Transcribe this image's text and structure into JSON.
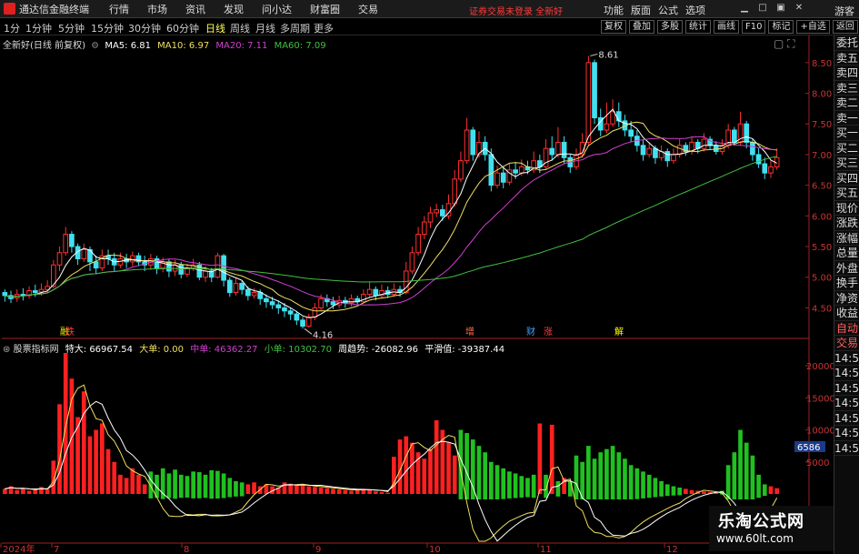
{
  "app": {
    "title": "通达信金融终端",
    "guest": "游客",
    "notice": "证券交易未登录 全新好"
  },
  "menu": [
    "行情",
    "市场",
    "资讯",
    "发现",
    "问小达",
    "财富圈",
    "交易"
  ],
  "right_menu": [
    "功能",
    "版面",
    "公式",
    "选项"
  ],
  "periods": [
    "1分",
    "1分钟",
    "5分钟",
    "15分钟",
    "30分钟",
    "60分钟",
    "日线",
    "周线",
    "月线",
    "多周期",
    "更多"
  ],
  "active_period": "日线",
  "toolbar": [
    "复权",
    "叠加",
    "多股",
    "统计",
    "画线",
    "F10",
    "标记",
    "+自选",
    "返回"
  ],
  "main_info": {
    "stock": "全新好(日线 前复权)",
    "ma5": "MA5: 6.81",
    "ma10": "MA10: 6.97",
    "ma20": "MA20: 7.11",
    "ma60": "MA60: 7.09",
    "colors": {
      "ma5": "#ffffff",
      "ma10": "#f0e060",
      "ma20": "#d040d0",
      "ma60": "#40c040"
    }
  },
  "annotations": {
    "high": "8.61",
    "low": "4.16"
  },
  "markers": [
    {
      "label": "融",
      "color": "#ffff00"
    },
    {
      "label": "跌",
      "color": "#ff4040"
    },
    {
      "label": "增",
      "color": "#ff7040"
    },
    {
      "label": "财",
      "color": "#40a0ff"
    },
    {
      "label": "涨",
      "color": "#ff4040"
    },
    {
      "label": "解",
      "color": "#ffff00"
    }
  ],
  "sub_info": {
    "name": "股票指标网",
    "te_da": "特大: 66967.54",
    "da_dan": "大单: 0.00",
    "zhong_dan": "中单: 46362.27",
    "xiao_dan": "小单: 10302.70",
    "zhou_qu_shi": "周趋势: -26082.96",
    "ping_hua": "平滑值: -39387.44",
    "colors": {
      "te_da": "#ffffff",
      "da_dan": "#f0e060",
      "zhong_dan": "#d040d0",
      "xiao_dan": "#40c040",
      "zhou_qu_shi": "#ffffff",
      "ping_hua": "#ffffff"
    }
  },
  "side_panel": [
    "委托",
    "卖五",
    "卖四",
    "卖三",
    "卖二",
    "卖一",
    "买一",
    "买二",
    "买三",
    "买四",
    "买五",
    "现价",
    "涨跌",
    "涨幅",
    "总量",
    "外盘",
    "换手",
    "净资",
    "收益",
    "自动",
    "交易",
    "14:55",
    "14:55",
    "14:55",
    "14:55",
    "14:55",
    "14:55",
    "14:55"
  ],
  "sub_price_tag": "6586",
  "x_axis": [
    "2024年",
    "7",
    "8",
    "9",
    "10",
    "11",
    "12"
  ],
  "watermark": {
    "title": "乐淘公式网",
    "url": "www.60lt.com"
  },
  "chart_data": [
    {
      "type": "candlestick",
      "title": "全新好(日线 前复权)",
      "y_ticks": [
        8.5,
        8.0,
        7.5,
        7.0,
        6.5,
        6.0,
        5.5,
        5.0,
        4.5
      ],
      "ylim": [
        4.15,
        8.75
      ],
      "annotations": [
        {
          "label": "8.61",
          "value": 8.61
        },
        {
          "label": "4.16",
          "value": 4.16
        }
      ],
      "x_labels": [
        "2024年",
        "7",
        "8",
        "9",
        "10",
        "11",
        "12"
      ],
      "candles": [
        [
          4.75,
          4.7,
          4.8,
          4.6
        ],
        [
          4.7,
          4.65,
          4.78,
          4.58
        ],
        [
          4.66,
          4.72,
          4.8,
          4.6
        ],
        [
          4.72,
          4.7,
          4.82,
          4.62
        ],
        [
          4.7,
          4.78,
          4.85,
          4.65
        ],
        [
          4.78,
          4.75,
          4.88,
          4.68
        ],
        [
          4.76,
          4.8,
          4.9,
          4.7
        ],
        [
          4.8,
          4.85,
          4.95,
          4.75
        ],
        [
          4.85,
          5.2,
          5.28,
          4.82
        ],
        [
          5.2,
          5.4,
          5.5,
          5.1
        ],
        [
          5.4,
          5.7,
          5.82,
          5.35
        ],
        [
          5.7,
          5.5,
          5.75,
          5.4
        ],
        [
          5.5,
          5.3,
          5.55,
          5.2
        ],
        [
          5.3,
          5.45,
          5.55,
          5.25
        ],
        [
          5.45,
          5.25,
          5.5,
          5.1
        ],
        [
          5.25,
          5.15,
          5.35,
          5.05
        ],
        [
          5.15,
          5.35,
          5.45,
          5.1
        ],
        [
          5.35,
          5.3,
          5.45,
          5.2
        ],
        [
          5.3,
          5.2,
          5.4,
          5.1
        ],
        [
          5.2,
          5.3,
          5.4,
          5.15
        ],
        [
          5.3,
          5.25,
          5.38,
          5.15
        ],
        [
          5.25,
          5.35,
          5.42,
          5.18
        ],
        [
          5.35,
          5.25,
          5.4,
          5.18
        ],
        [
          5.25,
          5.2,
          5.35,
          5.1
        ],
        [
          5.2,
          5.3,
          5.38,
          5.12
        ],
        [
          5.3,
          5.15,
          5.35,
          5.05
        ],
        [
          5.15,
          5.25,
          5.32,
          5.08
        ],
        [
          5.25,
          5.1,
          5.3,
          5.0
        ],
        [
          5.1,
          5.2,
          5.28,
          5.02
        ],
        [
          5.2,
          5.05,
          5.25,
          4.98
        ],
        [
          5.05,
          5.15,
          5.22,
          5.0
        ],
        [
          5.15,
          5.2,
          5.3,
          5.1
        ],
        [
          5.2,
          5.0,
          5.25,
          4.95
        ],
        [
          5.0,
          5.1,
          5.18,
          4.92
        ],
        [
          5.1,
          5.0,
          5.15,
          4.92
        ],
        [
          5.0,
          5.35,
          5.4,
          4.98
        ],
        [
          5.35,
          4.95,
          5.38,
          4.85
        ],
        [
          4.95,
          4.75,
          5.0,
          4.68
        ],
        [
          4.75,
          4.9,
          4.98,
          4.7
        ],
        [
          4.9,
          4.8,
          4.95,
          4.72
        ],
        [
          4.8,
          4.7,
          4.85,
          4.62
        ],
        [
          4.7,
          4.75,
          4.82,
          4.65
        ],
        [
          4.75,
          4.65,
          4.8,
          4.55
        ],
        [
          4.65,
          4.6,
          4.72,
          4.5
        ],
        [
          4.6,
          4.55,
          4.68,
          4.48
        ],
        [
          4.55,
          4.5,
          4.62,
          4.4
        ],
        [
          4.5,
          4.45,
          4.58,
          4.35
        ],
        [
          4.45,
          4.4,
          4.5,
          4.3
        ],
        [
          4.4,
          4.3,
          4.45,
          4.22
        ],
        [
          4.3,
          4.2,
          4.35,
          4.16
        ],
        [
          4.2,
          4.35,
          4.4,
          4.18
        ],
        [
          4.35,
          4.5,
          4.58,
          4.3
        ],
        [
          4.5,
          4.65,
          4.72,
          4.45
        ],
        [
          4.65,
          4.6,
          4.72,
          4.52
        ],
        [
          4.6,
          4.55,
          4.68,
          4.48
        ],
        [
          4.55,
          4.62,
          4.7,
          4.5
        ],
        [
          4.62,
          4.58,
          4.68,
          4.5
        ],
        [
          4.58,
          4.65,
          4.72,
          4.52
        ],
        [
          4.65,
          4.6,
          4.7,
          4.55
        ],
        [
          4.6,
          4.72,
          4.8,
          4.58
        ],
        [
          4.72,
          4.8,
          4.92,
          4.68
        ],
        [
          4.8,
          4.7,
          4.85,
          4.62
        ],
        [
          4.7,
          4.78,
          4.88,
          4.65
        ],
        [
          4.78,
          4.72,
          4.85,
          4.66
        ],
        [
          4.72,
          4.8,
          4.9,
          4.68
        ],
        [
          4.8,
          4.75,
          4.86,
          4.68
        ],
        [
          4.75,
          5.1,
          5.25,
          4.72
        ],
        [
          5.1,
          5.4,
          5.5,
          5.05
        ],
        [
          5.4,
          5.7,
          5.82,
          5.35
        ],
        [
          5.7,
          5.9,
          6.0,
          5.62
        ],
        [
          5.9,
          6.05,
          6.15,
          5.8
        ],
        [
          6.05,
          6.1,
          6.2,
          5.98
        ],
        [
          6.1,
          6.0,
          6.18,
          5.92
        ],
        [
          6.0,
          6.2,
          6.35,
          5.95
        ],
        [
          6.2,
          6.6,
          6.75,
          6.15
        ],
        [
          6.6,
          6.9,
          7.05,
          6.55
        ],
        [
          6.9,
          7.4,
          7.6,
          6.85
        ],
        [
          7.4,
          7.0,
          7.45,
          6.9
        ],
        [
          7.0,
          7.2,
          7.38,
          6.95
        ],
        [
          7.2,
          7.0,
          7.3,
          6.9
        ],
        [
          7.0,
          6.5,
          7.1,
          6.4
        ],
        [
          6.5,
          6.7,
          6.82,
          6.45
        ],
        [
          6.7,
          6.55,
          6.8,
          6.45
        ],
        [
          6.55,
          6.75,
          6.85,
          6.5
        ],
        [
          6.75,
          6.7,
          6.88,
          6.6
        ],
        [
          6.7,
          6.8,
          6.92,
          6.65
        ],
        [
          6.8,
          6.75,
          6.9,
          6.68
        ],
        [
          6.75,
          6.9,
          7.05,
          6.7
        ],
        [
          6.9,
          6.8,
          7.0,
          6.7
        ],
        [
          6.8,
          7.1,
          7.25,
          6.75
        ],
        [
          7.1,
          7.0,
          7.3,
          6.9
        ],
        [
          7.0,
          7.2,
          7.45,
          6.95
        ],
        [
          7.2,
          6.95,
          7.3,
          6.85
        ],
        [
          6.95,
          6.8,
          7.0,
          6.7
        ],
        [
          6.8,
          7.0,
          7.1,
          6.75
        ],
        [
          7.0,
          7.2,
          7.35,
          6.95
        ],
        [
          7.2,
          8.5,
          8.61,
          7.15
        ],
        [
          8.5,
          7.6,
          8.55,
          7.5
        ],
        [
          7.6,
          7.4,
          7.75,
          7.3
        ],
        [
          7.4,
          7.5,
          7.85,
          7.35
        ],
        [
          7.5,
          7.7,
          7.9,
          7.45
        ],
        [
          7.7,
          7.55,
          7.85,
          7.45
        ],
        [
          7.55,
          7.4,
          7.65,
          7.3
        ],
        [
          7.4,
          7.3,
          7.55,
          7.2
        ],
        [
          7.3,
          7.15,
          7.4,
          7.05
        ],
        [
          7.15,
          7.0,
          7.25,
          6.9
        ],
        [
          7.0,
          7.1,
          7.2,
          6.95
        ],
        [
          7.1,
          6.95,
          7.15,
          6.85
        ],
        [
          6.95,
          7.05,
          7.15,
          6.9
        ],
        [
          7.05,
          6.9,
          7.1,
          6.8
        ],
        [
          6.9,
          7.0,
          7.1,
          6.85
        ],
        [
          7.0,
          7.15,
          7.25,
          6.95
        ],
        [
          7.15,
          7.05,
          7.2,
          6.98
        ],
        [
          7.05,
          7.2,
          7.3,
          7.0
        ],
        [
          7.2,
          7.1,
          7.25,
          7.02
        ],
        [
          7.1,
          7.25,
          7.35,
          7.05
        ],
        [
          7.25,
          7.15,
          7.3,
          7.08
        ],
        [
          7.15,
          7.05,
          7.22,
          7.0
        ],
        [
          7.05,
          7.15,
          7.25,
          7.0
        ],
        [
          7.15,
          7.4,
          7.5,
          7.1
        ],
        [
          7.4,
          7.2,
          7.45,
          7.15
        ],
        [
          7.2,
          7.5,
          7.7,
          7.15
        ],
        [
          7.5,
          7.2,
          7.55,
          7.1
        ],
        [
          7.2,
          7.0,
          7.25,
          6.9
        ],
        [
          7.0,
          6.85,
          7.1,
          6.78
        ],
        [
          6.85,
          6.7,
          6.95,
          6.6
        ],
        [
          6.7,
          6.8,
          6.9,
          6.62
        ],
        [
          6.8,
          6.95,
          7.1,
          6.75
        ]
      ],
      "series": [
        {
          "name": "MA5",
          "last": 6.81
        },
        {
          "name": "MA10",
          "last": 6.97
        },
        {
          "name": "MA20",
          "last": 7.11
        },
        {
          "name": "MA60",
          "last": 7.09
        }
      ]
    },
    {
      "type": "bar",
      "title": "股票指标网",
      "y_ticks": [
        20000,
        15000,
        10000,
        5000
      ],
      "ylim": [
        0,
        22000
      ],
      "values": [
        800,
        1200,
        600,
        900,
        500,
        700,
        1100,
        800,
        5200,
        14000,
        22000,
        18000,
        12000,
        16000,
        9000,
        10000,
        11000,
        7000,
        5000,
        3000,
        2500,
        4000,
        3000,
        1500,
        -3500,
        -3000,
        -4000,
        -3200,
        -3800,
        -3000,
        -2800,
        -3500,
        -3400,
        -3000,
        -3700,
        -3600,
        -3200,
        -2500,
        -2000,
        -1800,
        1500,
        1800,
        1200,
        1500,
        1200,
        1000,
        1800,
        1600,
        1400,
        1300,
        1200,
        1100,
        1000,
        900,
        800,
        700,
        600,
        500,
        700,
        800,
        600,
        400,
        300,
        200,
        5800,
        8500,
        9000,
        8000,
        6500,
        5500,
        7000,
        11500,
        10000,
        8000,
        6000,
        -10000,
        -9500,
        -8500,
        -7500,
        -6500,
        -5000,
        -4500,
        -4000,
        -3500,
        -3200,
        -2800,
        -2500,
        -3000,
        11000,
        -3000,
        10800,
        -2000,
        2500,
        -2000,
        -6000,
        -5000,
        -7500,
        -5500,
        -6500,
        -7000,
        -7500,
        -6500,
        -5500,
        -4500,
        -4000,
        -3500,
        -3000,
        -2500,
        -2000,
        -1500,
        -1200,
        -1000,
        800,
        600,
        500,
        400,
        300,
        200,
        -500,
        -4500,
        -6500,
        -10000,
        -8000,
        -6000,
        -3000,
        -1500,
        1200,
        900
      ],
      "series": [
        {
          "name": "特大",
          "last": 66967.54
        },
        {
          "name": "大单",
          "last": 0.0
        },
        {
          "name": "中单",
          "last": 46362.27
        },
        {
          "name": "小单",
          "last": 10302.7
        },
        {
          "name": "周趋势",
          "last": -26082.96
        },
        {
          "name": "平滑值",
          "last": -39387.44
        }
      ]
    }
  ]
}
